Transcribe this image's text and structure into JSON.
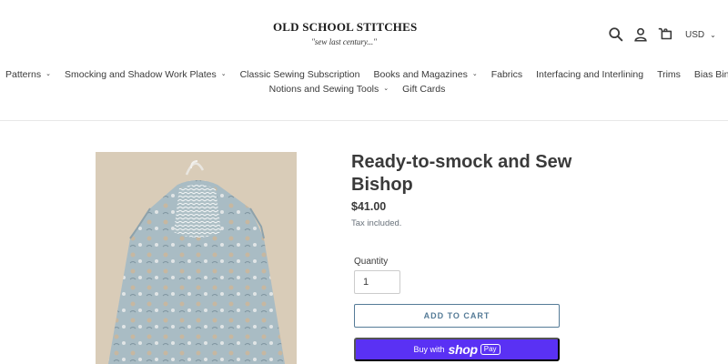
{
  "store": {
    "name": "OLD SCHOOL STITCHES",
    "tagline": "\"sew last century...\""
  },
  "header_icons": [
    "search-icon",
    "account-icon",
    "cart-icon"
  ],
  "currency": {
    "selected": "USD"
  },
  "nav": {
    "row1": [
      {
        "label": "Patterns",
        "dropdown": true
      },
      {
        "label": "Smocking and Shadow Work Plates",
        "dropdown": true
      },
      {
        "label": "Classic Sewing Subscription",
        "dropdown": false
      },
      {
        "label": "Books and Magazines",
        "dropdown": true
      },
      {
        "label": "Fabrics",
        "dropdown": false
      },
      {
        "label": "Interfacing and Interlining",
        "dropdown": false
      },
      {
        "label": "Trims",
        "dropdown": false
      },
      {
        "label": "Bias Binding",
        "dropdown": false
      }
    ],
    "row2": [
      {
        "label": "Notions and Sewing Tools",
        "dropdown": true
      },
      {
        "label": "Gift Cards",
        "dropdown": false
      }
    ]
  },
  "product": {
    "title": "Ready-to-smock and Sew Bishop",
    "price": "$41.00",
    "tax_note": "Tax included.",
    "quantity_label": "Quantity",
    "quantity_value": "1",
    "add_to_cart_label": "ADD TO CART",
    "shop_pay": {
      "prefix": "Buy with",
      "brand": "shop",
      "badge": "Pay"
    }
  },
  "colors": {
    "accent": "#557b97",
    "shop_pay": "#5a31f4",
    "text": "#3a3a3a"
  }
}
